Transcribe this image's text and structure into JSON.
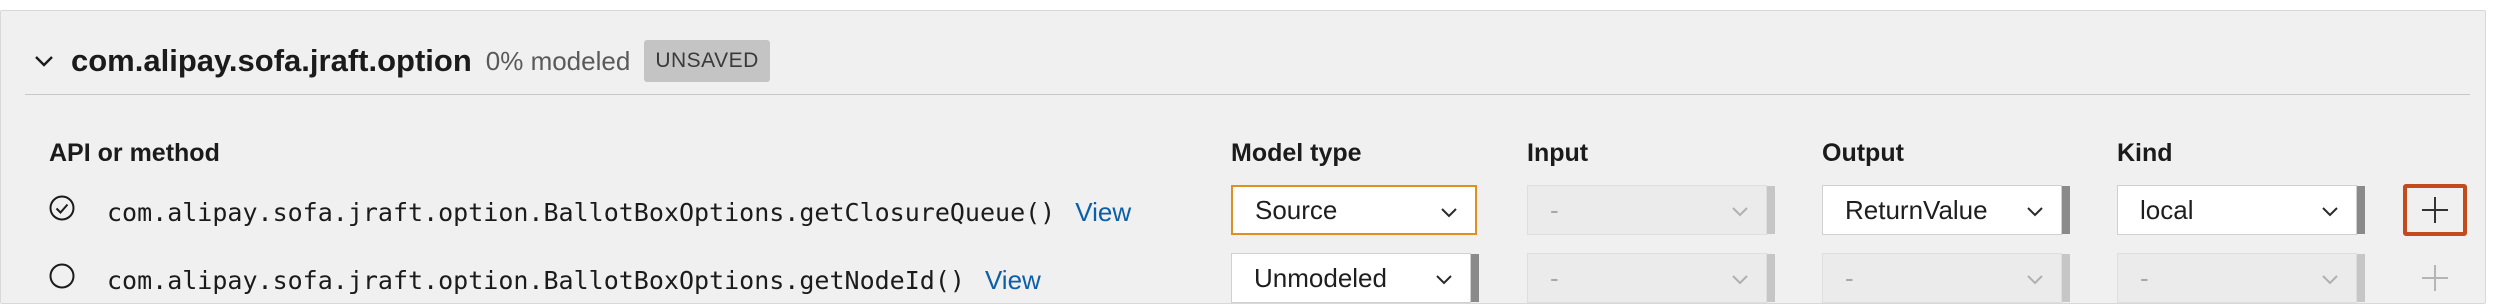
{
  "header": {
    "package_name": "com.alipay.sofa.jraft.option",
    "percent_modeled": "0% modeled",
    "status_badge": "UNSAVED"
  },
  "columns": {
    "api": "API or method",
    "model_type": "Model type",
    "input": "Input",
    "output": "Output",
    "kind": "Kind"
  },
  "rows": [
    {
      "selected": true,
      "method": "com.alipay.sofa.jraft.option.BallotBoxOptions.getClosureQueue()",
      "view_label": "View",
      "model_type": "Source",
      "input": "-",
      "output": "ReturnValue",
      "kind": "local",
      "add_icon": "plus-icon"
    },
    {
      "selected": false,
      "method": "com.alipay.sofa.jraft.option.BallotBoxOptions.getNodeId()",
      "view_label": "View",
      "model_type": "Unmodeled",
      "input": "-",
      "output": "-",
      "kind": "-",
      "add_icon": "plus-icon"
    }
  ],
  "colors": {
    "link": "#0b5fa8",
    "focus_border": "#e0901f",
    "active_button_border": "#c24a1c"
  }
}
